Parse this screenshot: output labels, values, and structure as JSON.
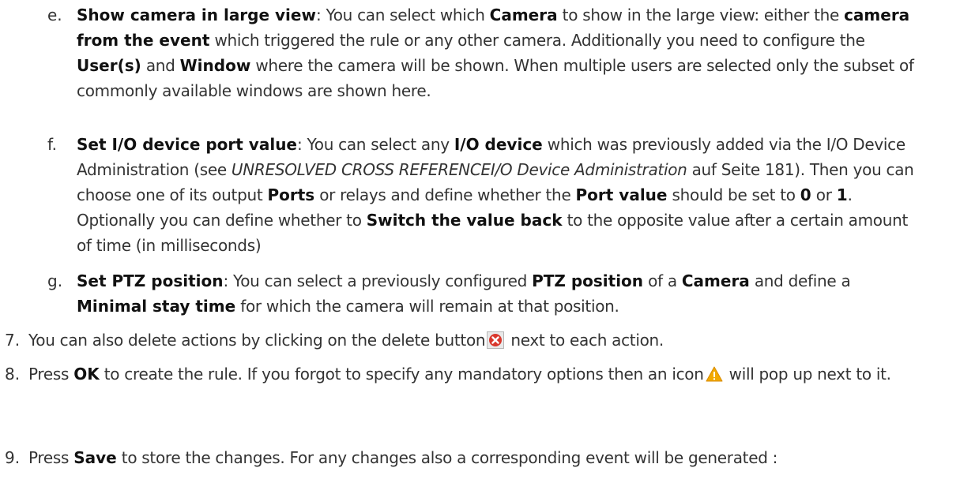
{
  "items": [
    {
      "marker": "e.",
      "title": "Show camera in large view",
      "text_1": ": You can select which ",
      "bold_1": "Camera",
      "text_2": " to show in the large view: either the ",
      "bold_2": "camera from the event",
      "text_3": " which triggered the rule or any other camera. Additionally you need to configure the ",
      "bold_3": "User(s)",
      "text_4": " and ",
      "bold_4": "Window",
      "text_5": " where the camera will be shown. When multiple users are selected only the subset of commonly available windows are shown here."
    },
    {
      "marker": "f.",
      "title": "Set I/O device port value",
      "text_1": ": You can select any ",
      "bold_1": "I/O device",
      "text_2": " which was previously added via the I/O Device Administration (see ",
      "italic_1": "UNRESOLVED CROSS REFERENCEI/O Device Administration",
      "text_3": " auf Seite 181). Then you can choose one of its output ",
      "bold_2": "Ports",
      "text_4": " or relays and define whether the ",
      "bold_3": "Port value",
      "text_5": " should be set to ",
      "bold_4": "0",
      "text_6": " or ",
      "bold_5": "1",
      "text_7": ". Optionally you can define whether to ",
      "bold_6": "Switch the value back",
      "text_8": " to the opposite value after a certain amount of time (in milliseconds)"
    },
    {
      "marker": "g.",
      "title": "Set PTZ position",
      "text_1": ": You can select a previously configured ",
      "bold_1": "PTZ position",
      "text_2": " of a ",
      "bold_2": "Camera",
      "text_3": " and define a ",
      "bold_3": "Minimal stay time",
      "text_4": " for which the camera will remain at that position."
    }
  ],
  "steps": [
    {
      "marker": "7.",
      "text_1": "You can also delete actions by clicking on the delete button",
      "icon": "delete-icon",
      "text_2": " next to each action."
    },
    {
      "marker": "8.",
      "text_1": "Press ",
      "bold_1": "OK",
      "text_2": " to create the rule. If you forgot to specify any mandatory options then an icon",
      "icon": "warning-icon",
      "text_3": " will pop up next to it."
    },
    {
      "marker": "9.",
      "text_1": "Press ",
      "bold_1": "Save",
      "text_2": " to store the changes. For any changes also a corresponding event will be generated :"
    }
  ],
  "colors": {
    "text": "#333333",
    "bold": "#111111",
    "delete_icon": "#d9372c",
    "warning_icon": "#f2a900"
  }
}
